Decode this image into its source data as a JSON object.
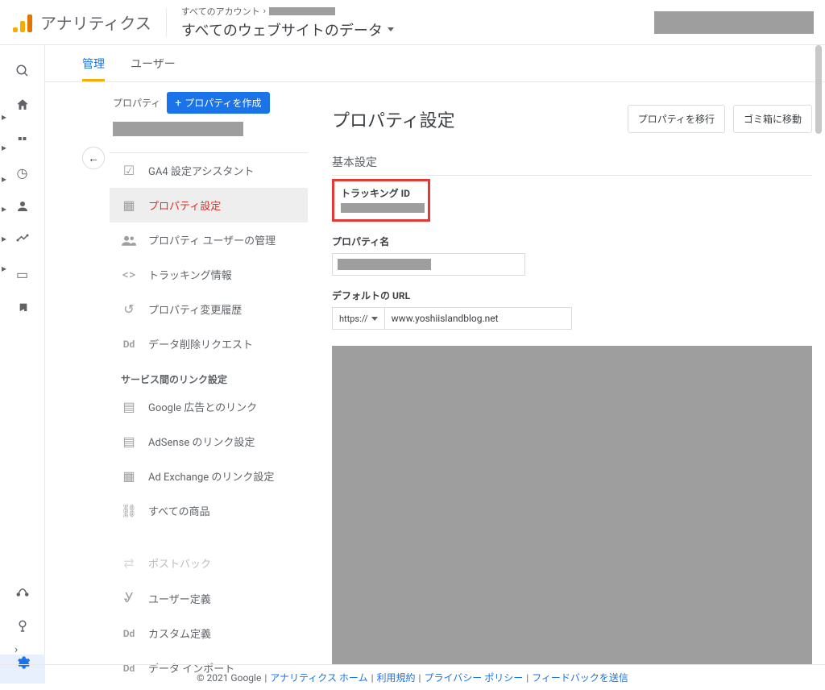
{
  "header": {
    "app_title": "アナリティクス",
    "accounts_label": "すべてのアカウント",
    "view_title": "すべてのウェブサイトのデータ"
  },
  "tabs": {
    "admin": "管理",
    "users": "ユーザー"
  },
  "property": {
    "head_label": "プロパティ",
    "create_label": "プロパティを作成"
  },
  "menu": {
    "ga4_assistant": "GA4 設定アシスタント",
    "property_settings": "プロパティ設定",
    "users": "プロパティ ユーザーの管理",
    "tracking_info": "トラッキング情報",
    "change_history": "プロパティ変更履歴",
    "delete_request": "データ削除リクエスト",
    "section_link": "サービス間のリンク設定",
    "ads_link": "Google 広告とのリンク",
    "adsense_link": "AdSense のリンク設定",
    "adexchange_link": "Ad Exchange のリンク設定",
    "all_products": "すべての商品",
    "postback": "ポストバック",
    "user_def": "ユーザー定義",
    "custom_def": "カスタム定義",
    "data_import": "データ インポート"
  },
  "form": {
    "title": "プロパティ設定",
    "move_btn": "プロパティを移行",
    "trash_btn": "ゴミ箱に移動",
    "basic_section": "基本設定",
    "tracking_id_label": "トラッキング ID",
    "property_name_label": "プロパティ名",
    "default_url_label": "デフォルトの URL",
    "protocol": "https://",
    "url_value": "www.yoshiislandblog.net"
  },
  "footer": {
    "copyright": "© 2021 Google",
    "home": "アナリティクス ホーム",
    "terms": "利用規約",
    "privacy": "プライバシー ポリシー",
    "feedback": "フィードバックを送信"
  }
}
